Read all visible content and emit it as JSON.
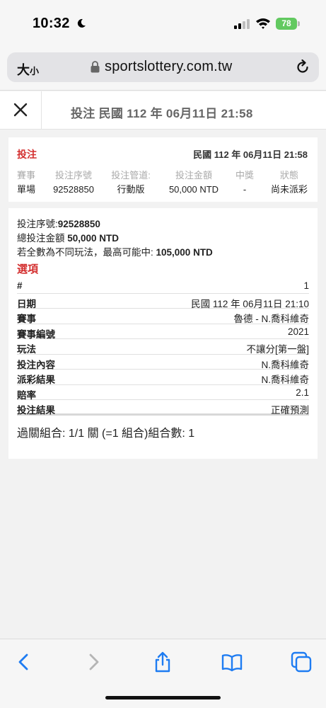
{
  "status_bar": {
    "time": "10:32",
    "battery": "78"
  },
  "browser": {
    "text_size_label": "大",
    "text_size_small": "小",
    "url": "sportslottery.com.tw"
  },
  "header": {
    "title": "投注 民國 112 年 06月11日 21:58"
  },
  "summary": {
    "type": "投注",
    "date": "民國 112 年 06月11日 21:58",
    "columns": [
      {
        "head": "賽事",
        "value": "單場"
      },
      {
        "head": "投注序號",
        "value": "92528850"
      },
      {
        "head": "投注管道:",
        "value": "行動版"
      },
      {
        "head": "投注金額",
        "value": "50,000 NTD"
      },
      {
        "head": "中獎",
        "value": "-"
      },
      {
        "head": "狀態",
        "value": "尚未派彩"
      }
    ]
  },
  "detail": {
    "serial_label": "投注序號:",
    "serial_value": "92528850",
    "total_label": "總投注金額 ",
    "total_value": "50,000 NTD",
    "max_label": "若全數為不同玩法，最高可能中: ",
    "max_value": "105,000 NTD",
    "options_heading": "選項",
    "rows": [
      {
        "key": "#",
        "value": "1"
      },
      {
        "key": "日期",
        "value": "民國 112 年 06月11日 21:10"
      },
      {
        "key": "賽事",
        "value": "魯德 - N.喬科維奇"
      },
      {
        "key": "賽事編號",
        "value": "2021"
      },
      {
        "key": "玩法",
        "value": "不讓分[第一盤]"
      },
      {
        "key": "投注內容",
        "value": "N.喬科維奇"
      },
      {
        "key": "派彩結果",
        "value": "N.喬科維奇"
      },
      {
        "key": "賠率",
        "value": "2.1"
      },
      {
        "key": "投注結果",
        "value": "正確預測"
      }
    ],
    "combo": "過關組合: 1/1 關 (=1 組合)組合數: 1"
  },
  "toolbar": {
    "icons": [
      "back-icon",
      "forward-icon",
      "share-icon",
      "bookmarks-icon",
      "tabs-icon"
    ],
    "accent": "#1e7cf2",
    "disabled": "#b5b5b5"
  }
}
